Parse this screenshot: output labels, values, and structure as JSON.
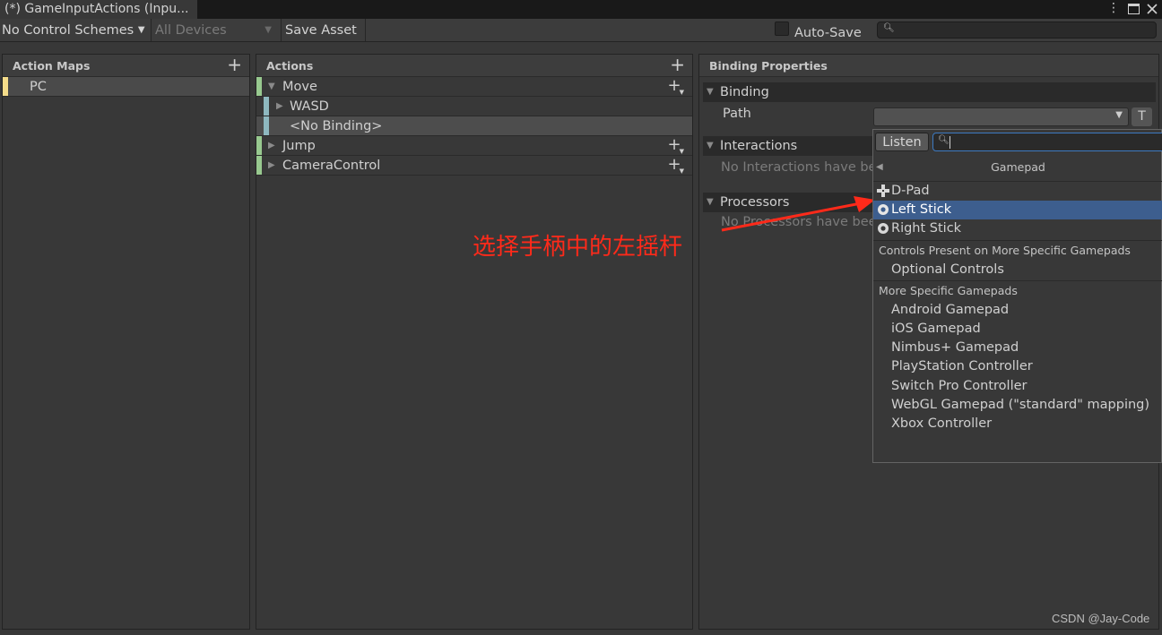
{
  "window": {
    "tab_title": "(*) GameInputActions (Inpu...",
    "menu_icon": "kebab-menu-icon",
    "maximize_icon": "maximize-icon",
    "close_icon": "close-icon"
  },
  "toolbar": {
    "control_scheme": "No Control Schemes",
    "devices": "All Devices",
    "save_label": "Save Asset",
    "auto_save_label": "Auto-Save",
    "auto_save_checked": false,
    "search_value": "",
    "search_placeholder": ""
  },
  "action_maps": {
    "title": "Action Maps",
    "items": [
      {
        "label": "PC",
        "color": "#f5dc8a",
        "selected": true
      }
    ]
  },
  "actions": {
    "title": "Actions",
    "items": [
      {
        "label": "Move",
        "expanded": true,
        "color": "#98c98f"
      },
      {
        "label": "WASD",
        "child": true,
        "expanded": false,
        "color": "#8eb8bf"
      },
      {
        "label": "<No Binding>",
        "child": true,
        "selected": true,
        "color": "#8eb8bf"
      },
      {
        "label": "Jump",
        "expanded": false,
        "color": "#98c98f"
      },
      {
        "label": "CameraControl",
        "expanded": false,
        "color": "#98c98f"
      }
    ]
  },
  "binding_properties": {
    "title": "Binding Properties",
    "binding_section": "Binding",
    "path_label": "Path",
    "path_value": "",
    "t_button": "T",
    "interactions_section": "Interactions",
    "interactions_empty": "No Interactions have be",
    "processors_section": "Processors",
    "processors_empty": "No Processors have bee"
  },
  "path_popup": {
    "listen_label": "Listen",
    "search_value": "",
    "header": "Gamepad",
    "items": [
      {
        "label": "D-Pad",
        "icon": "dpad-icon"
      },
      {
        "label": "Left Stick",
        "icon": "stick-icon",
        "selected": true
      },
      {
        "label": "Right Stick",
        "icon": "stick-icon"
      }
    ],
    "group1_title": "Controls Present on More Specific Gamepads",
    "group1_items": [
      "Optional Controls"
    ],
    "group2_title": "More Specific Gamepads",
    "group2_items": [
      "Android Gamepad",
      "iOS Gamepad",
      "Nimbus+ Gamepad",
      "PlayStation Controller",
      "Switch Pro Controller",
      "WebGL Gamepad (\"standard\" mapping)",
      "Xbox Controller"
    ],
    "selected_color": "#3d5e8e"
  },
  "annotation": {
    "text": "选择手柄中的左摇杆",
    "color": "#ff2a1a"
  },
  "watermark": "CSDN @Jay-Code"
}
